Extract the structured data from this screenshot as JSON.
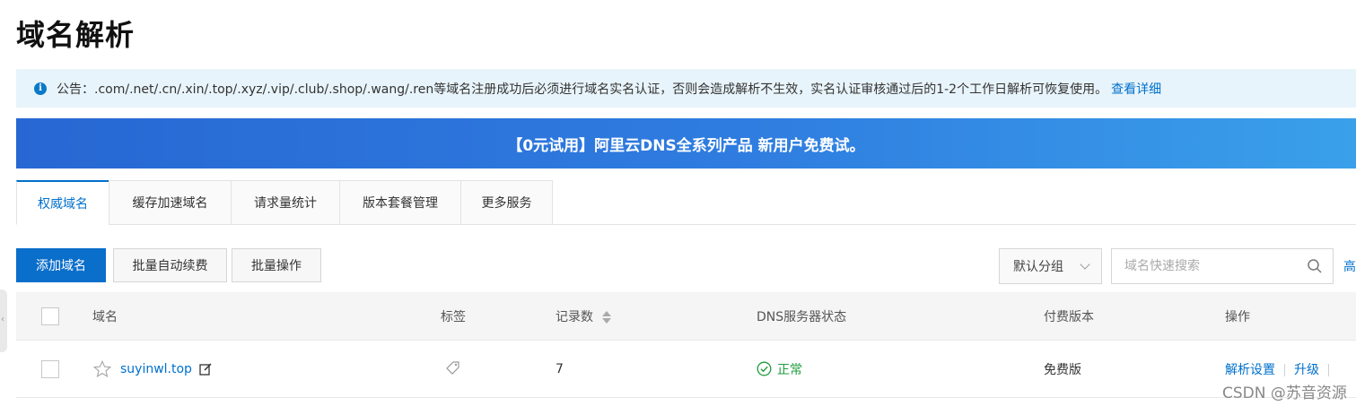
{
  "page": {
    "title": "域名解析"
  },
  "notice": {
    "text": "公告：.com/.net/.cn/.xin/.top/.xyz/.vip/.club/.shop/.wang/.ren等域名注册成功后必须进行域名实名认证，否则会造成解析不生效，实名认证审核通过后的1-2个工作日解析可恢复使用。",
    "link": "查看详细",
    "icon": "info-icon"
  },
  "banner": {
    "text": "【0元试用】阿里云DNS全系列产品 新用户免费试。"
  },
  "tabs": [
    {
      "label": "权威域名",
      "active": true
    },
    {
      "label": "缓存加速域名"
    },
    {
      "label": "请求量统计"
    },
    {
      "label": "版本套餐管理"
    },
    {
      "label": "更多服务"
    }
  ],
  "toolbar": {
    "add_domain": "添加域名",
    "batch_renew": "批量自动续费",
    "batch_ops": "批量操作",
    "group_select": "默认分组",
    "search_placeholder": "域名快速搜索",
    "advanced": "高"
  },
  "table": {
    "columns": [
      "域名",
      "标签",
      "记录数",
      "DNS服务器状态",
      "付费版本",
      "操作"
    ],
    "rows": [
      {
        "domain": "suyinwl.top",
        "records": "7",
        "dns_status": "正常",
        "edition": "免费版",
        "actions": [
          "解析设置",
          "升级"
        ]
      }
    ]
  },
  "side_handle": "‹",
  "watermark": "CSDN @苏音资源",
  "colors": {
    "accent": "#0070cc",
    "primary_button": "#0a6ecb",
    "success": "#1e9c3c",
    "notice_bg": "#e8f4fb"
  }
}
